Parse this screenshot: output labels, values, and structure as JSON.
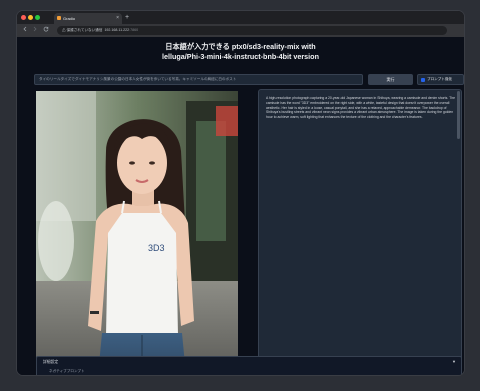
{
  "browser": {
    "tab_title": "Gradio",
    "tab_close": "×",
    "new_tab": "+",
    "url_host": "保護されていない通信",
    "url_main": "192.168.11.222",
    "url_port": ":7860"
  },
  "app": {
    "title_line1": "日本語が入力できる ptx0/sd3-reality-mix with",
    "title_line2": "lelluga/Phi-3-mini-4k-instruct-bnb-4bit version",
    "prompt_value": "タイのリールタイズでダイナモアナリシ風景の公園の日本人女性が街を歩いている写真。キャミソールの肩紐に白のポスト",
    "run_label": "実行",
    "checkbox_label": "プロンプト強化",
    "description": "A high-resolution photograph capturing a 20-year-old Japanese woman in Shibuya, wearing a camisole and denim shorts. The camisole has the word \"3D3\" embroidered on the right side, with a white, tasteful design that doesn't overpower the overall aesthetic. Her hair is styled in a loose, casual ponytail, and she has a relaxed, approachable demeanor. The backdrop of Shibuya's bustling streets and vibrant neon signs provides a vibrant urban atmosphere. The image is taken during the golden hour to achieve warm, soft lighting that enhances the texture of the clothing and the character's features.",
    "camisole_text": "3D3",
    "accordion_title": "詳細設定",
    "accordion_caret": "▼",
    "accordion_item": "ネガティブプロンプト"
  },
  "colors": {
    "background": "#0b0f19",
    "panel": "#1f2937",
    "accent": "#2563eb"
  }
}
